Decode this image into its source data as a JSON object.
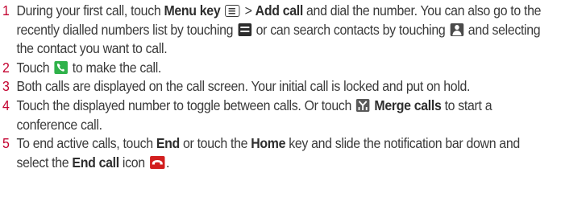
{
  "steps": [
    {
      "num": "1",
      "parts": {
        "t1": "During your first call, touch ",
        "b1": "Menu key",
        "t2": " > ",
        "b2": "Add call",
        "t3": " and dial the number. You can also go to the recently dialled numbers list by touching ",
        "t4": " or can search contacts by touching ",
        "t5": " and selecting the contact you want to call."
      }
    },
    {
      "num": "2",
      "parts": {
        "t1": "Touch ",
        "t2": " to make the call."
      }
    },
    {
      "num": "3",
      "parts": {
        "t1": "Both calls are displayed on the call screen. Your initial call is locked and put on hold."
      }
    },
    {
      "num": "4",
      "parts": {
        "t1": "Touch the displayed number to toggle between calls. Or touch ",
        "b1": "Merge calls",
        "t2": " to start a conference call."
      }
    },
    {
      "num": "5",
      "parts": {
        "t1": "To end active calls, touch ",
        "b1": "End",
        "t2": " or touch the ",
        "b2": "Home",
        "t3": " key and slide the notification bar down and select the ",
        "b3": "End call",
        "t4": " icon ",
        "t5": "."
      }
    }
  ],
  "icons": {
    "menu": "menu-key-icon",
    "recent": "recent-calls-icon",
    "contacts": "contacts-icon",
    "call": "call-phone-icon",
    "merge": "merge-calls-icon",
    "end": "end-call-icon"
  },
  "colors": {
    "step_number": "#c3002f",
    "call_icon": "#2fb24a",
    "end_icon": "#d21f1f"
  }
}
